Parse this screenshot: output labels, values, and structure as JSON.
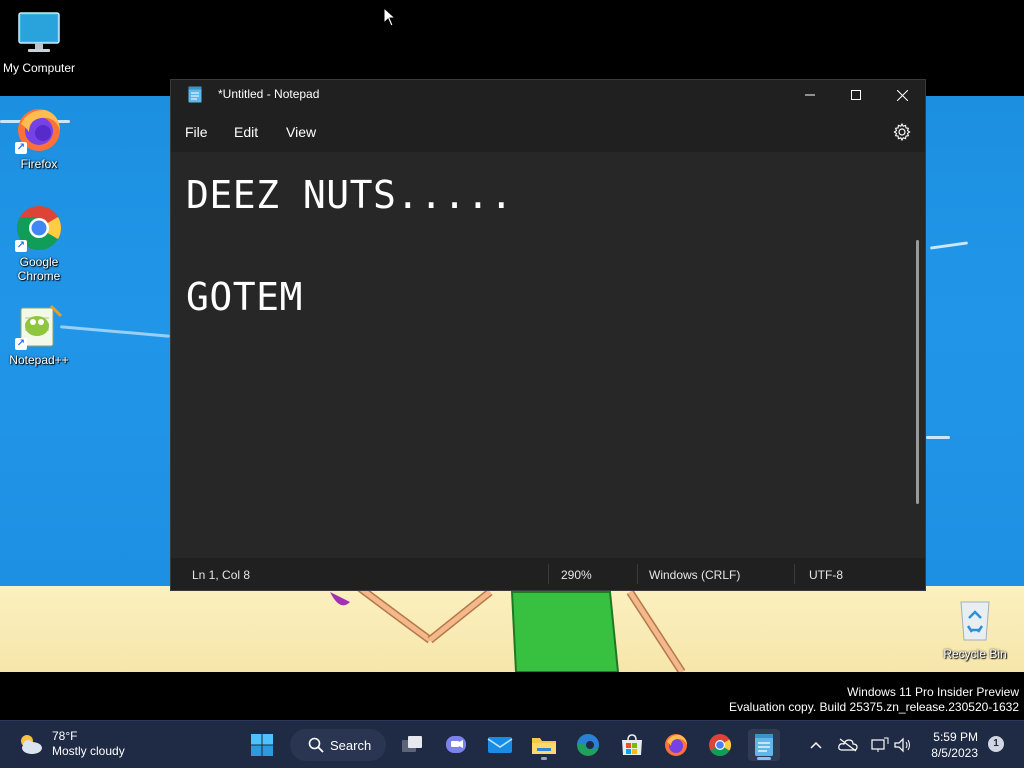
{
  "desktop": {
    "icons": [
      {
        "label": "My Computer",
        "icon": "monitor-icon"
      },
      {
        "label": "Firefox",
        "icon": "firefox-icon"
      },
      {
        "label": "Google Chrome",
        "icon": "chrome-icon"
      },
      {
        "label": "Notepad++",
        "icon": "notepadpp-icon"
      },
      {
        "label": "Recycle Bin",
        "icon": "recycle-bin-icon"
      }
    ]
  },
  "notepad": {
    "title": "*Untitled - Notepad",
    "menu": [
      "File",
      "Edit",
      "View"
    ],
    "content": "DEEZ NUTS.....\n\nGOTEM",
    "status": {
      "position": "Ln 1, Col 8",
      "zoom": "290%",
      "line_ending": "Windows (CRLF)",
      "encoding": "UTF-8"
    }
  },
  "watermark": {
    "line1": "Windows 11 Pro Insider Preview",
    "line2": "Evaluation copy. Build 25375.zn_release.230520-1632"
  },
  "taskbar": {
    "weather": {
      "temp": "78°F",
      "condition": "Mostly cloudy"
    },
    "search_label": "Search",
    "apps": [
      "start",
      "search",
      "task-view",
      "teams-chat",
      "mail",
      "file-explorer",
      "edge",
      "microsoft-store",
      "firefox",
      "chrome",
      "notepad"
    ],
    "clock": {
      "time": "5:59 PM",
      "date": "8/5/2023"
    },
    "notification_count": "1"
  },
  "colors": {
    "accent": "#7fc4ff",
    "window_bg": "#202020",
    "editor_bg": "#272727",
    "taskbar_bg": "#1f2a44"
  }
}
